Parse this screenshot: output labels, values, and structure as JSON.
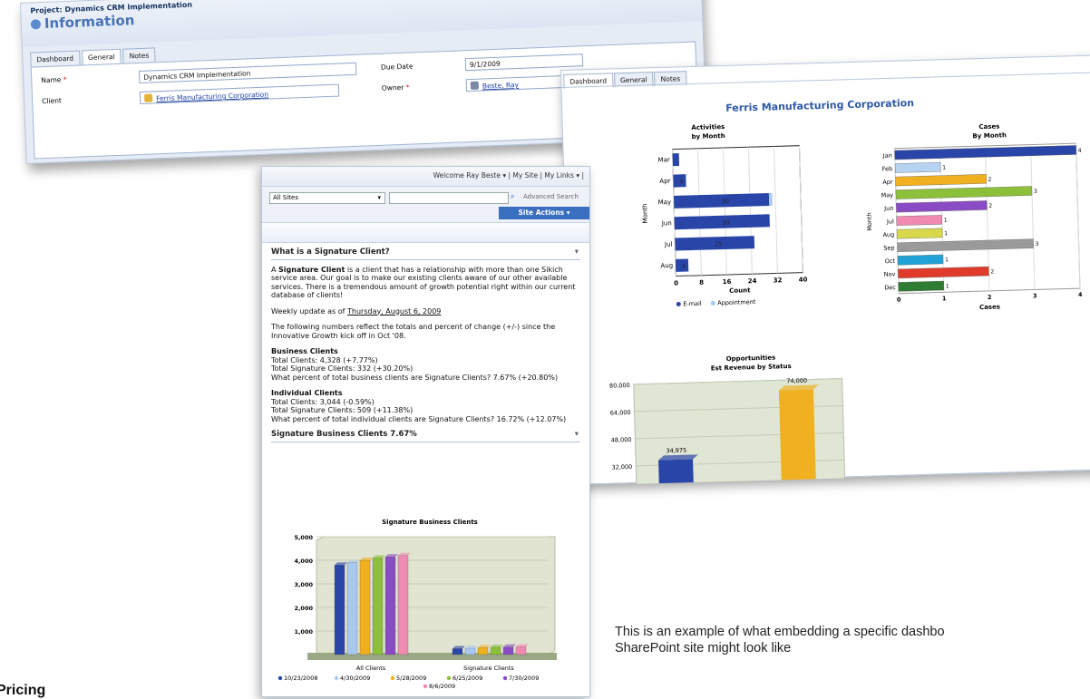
{
  "crm": {
    "project": "Project: Dynamics CRM Implementation",
    "heading": "Information",
    "tabs": [
      "Dashboard",
      "General",
      "Notes"
    ],
    "name_label": "Name",
    "name_value": "Dynamics CRM Implementation",
    "client_label": "Client",
    "client_value": "Ferris Manufacturing Corporation",
    "due_label": "Due Date",
    "due_value": "9/1/2009",
    "owner_label": "Owner",
    "owner_value": "Beste, Ray"
  },
  "dashboard": {
    "tabs": [
      "Dashboard",
      "General",
      "Notes"
    ],
    "title": "Ferris Manufacturing Corporation",
    "activities_title": "Activities",
    "activities_subtitle": "by Month",
    "cases_title": "Cases",
    "cases_subtitle": "By Month",
    "opps_title": "Opportunities",
    "opps_subtitle": "Est Revenue by Status"
  },
  "sharepoint": {
    "welcome": "Welcome Ray Beste ▾  |  My Site  |  My Links ▾  |",
    "sites": "All Sites",
    "advanced_search": "Advanced Search",
    "site_actions": "Site Actions ▾",
    "wp1_title": "What is a Signature Client?",
    "intro_pre": "A ",
    "intro_bold": "Signature Client",
    "intro_post": " is a client that has a relationship with more than one Sikich service area. Our goal is to make our existing clients aware of our other available services. There is a tremendous amount of growth potential right within our current database of clients!",
    "weekly_pre": "Weekly update as of ",
    "weekly_date": "Thursday, August 6, 2009",
    "numbers_note": "The following numbers reflect the totals and percent of change (+/-) since the Innovative Growth kick off in Oct '08.",
    "business_title": "Business Clients",
    "business_lines": [
      "Total Clients: 4,328 (+7.77%)",
      "Total Signature Clients: 332 (+30.20%)",
      "What percent of total business clients are Signature Clients? 7.67% (+20.80%)"
    ],
    "individual_title": "Individual Clients",
    "individual_lines": [
      "Total Clients: 3,044 (-0.59%)",
      "Total Signature Clients: 509 (+11.38%)",
      "What percent of total individual clients are Signature Clients? 16.72% (+12.07%)"
    ],
    "wp2_title": "Signature Business Clients 7.67%"
  },
  "caption": "This is an example of what embedding a specific dashbo\nSharePoint site might look like",
  "pricing": "Pricing",
  "chart_data": [
    {
      "type": "bar",
      "title": "Activities",
      "subtitle": "by Month",
      "orientation": "horizontal",
      "categories": [
        "Mar",
        "Apr",
        "May",
        "Jun",
        "Jul",
        "Aug"
      ],
      "series": [
        {
          "name": "E-mail",
          "values": [
            2,
            4,
            30,
            30,
            25,
            4
          ]
        },
        {
          "name": "Appointment",
          "values": [
            0,
            0,
            1,
            0,
            0,
            0
          ]
        }
      ],
      "data_labels": [
        "",
        "4",
        "30",
        "30",
        "25",
        "4"
      ],
      "xlabel": "Count",
      "ylabel": "Month",
      "xticks": [
        "0",
        "8",
        "16",
        "24",
        "32",
        "40"
      ],
      "xlim": [
        0,
        40
      ],
      "colors": [
        "#2a45a8",
        "#a9c8f0"
      ]
    },
    {
      "type": "bar",
      "title": "Cases",
      "subtitle": "By Month",
      "orientation": "horizontal",
      "categories": [
        "Jan",
        "Feb",
        "Apr",
        "May",
        "Jun",
        "Jul",
        "Aug",
        "Sep",
        "Oct",
        "Nov",
        "Dec"
      ],
      "values": [
        4,
        1,
        2,
        3,
        2,
        1,
        1,
        3,
        1,
        2,
        1
      ],
      "colors": [
        "#2a45a8",
        "#b6d4f2",
        "#f0b020",
        "#8cbf3a",
        "#8a4cc4",
        "#f08ab0",
        "#d8d84a",
        "#9a9a9a",
        "#21a3d8",
        "#e03a2a",
        "#2e7d32"
      ],
      "xlabel": "Cases",
      "ylabel": "Month",
      "xticks": [
        "0",
        "1",
        "2",
        "3",
        "4"
      ],
      "xlim": [
        0,
        4
      ]
    },
    {
      "type": "bar",
      "title": "Opportunities",
      "subtitle": "Est Revenue by Status",
      "values": [
        34975,
        74000
      ],
      "data_labels": [
        "34,975",
        "74,000"
      ],
      "yticks": [
        "80,000",
        "64,000",
        "48,000",
        "32,000"
      ],
      "colors": [
        "#2a45a8",
        "#f0b020"
      ]
    },
    {
      "type": "bar",
      "title": "Signature Business Clients",
      "categories": [
        "All Clients",
        "Signature Clients"
      ],
      "series": [
        {
          "name": "10/23/2008",
          "values": [
            3800,
            250
          ]
        },
        {
          "name": "4/30/2009",
          "values": [
            3900,
            270
          ]
        },
        {
          "name": "5/28/2009",
          "values": [
            4000,
            290
          ]
        },
        {
          "name": "6/25/2009",
          "values": [
            4100,
            310
          ]
        },
        {
          "name": "7/30/2009",
          "values": [
            4150,
            320
          ]
        },
        {
          "name": "8/6/2009",
          "values": [
            4200,
            332
          ]
        }
      ],
      "yticks": [
        "5,000",
        "4,000",
        "3,000",
        "2,000",
        "1,000",
        "0"
      ],
      "ylim": [
        0,
        5000
      ],
      "colors": [
        "#2a45a8",
        "#a9c8f0",
        "#f0b020",
        "#8cbf3a",
        "#8a4cc4",
        "#f08ab0"
      ]
    }
  ]
}
